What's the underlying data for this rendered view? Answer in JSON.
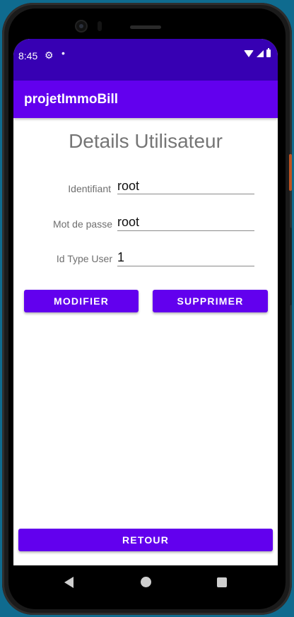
{
  "statusbar": {
    "time": "8:45",
    "icons": [
      "gear-icon",
      "notification-dot-icon",
      "wifi-icon",
      "signal-icon",
      "battery-icon"
    ]
  },
  "appbar": {
    "title": "projetImmoBill"
  },
  "page": {
    "title": "Details Utilisateur"
  },
  "fields": [
    {
      "label": "Identifiant",
      "value": "root"
    },
    {
      "label": "Mot de passe",
      "value": "root"
    },
    {
      "label": "Id Type User",
      "value": "1"
    }
  ],
  "buttons": {
    "modify": "MODIFIER",
    "delete": "SUPPRIMER",
    "back": "RETOUR"
  },
  "colors": {
    "primary": "#6200ee",
    "primary_dark": "#3700b3",
    "background": "#0f6b8f"
  },
  "navbar": {
    "icons": [
      "back-icon",
      "home-icon",
      "recents-icon"
    ]
  }
}
